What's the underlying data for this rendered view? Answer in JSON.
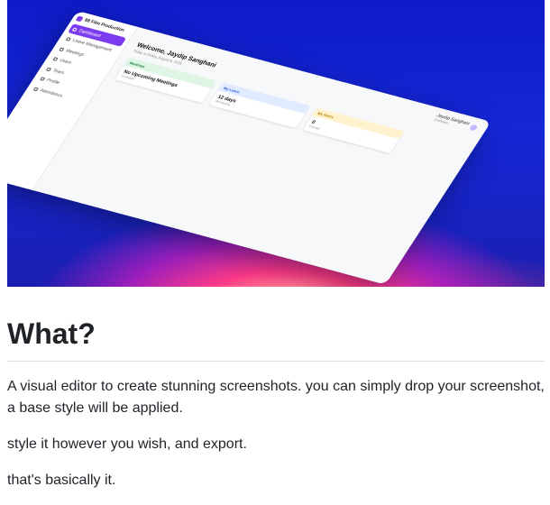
{
  "preview": {
    "app_name": "88 Film Production",
    "nav": [
      "Dashboard",
      "Leave Management",
      "Meetings",
      "Users",
      "Team",
      "Profile",
      "Attendance"
    ],
    "user_name": "Jaydip Sanghani",
    "user_role": "Employee",
    "welcome": "Welcome, Jaydip Sanghani",
    "date_line": "Today is Friday, August 8, 2025",
    "cards": [
      {
        "title": "Meetings",
        "value": "No Upcoming Meetings",
        "sub": "Schedule"
      },
      {
        "title": "My Leave",
        "value": "12 days",
        "sub": "Remaining"
      },
      {
        "title": "My Alerts",
        "value": "0",
        "sub": "Unread"
      }
    ]
  },
  "heading": "What?",
  "paragraphs": [
    "A visual editor to create stunning screenshots. you can simply drop your screenshot, a base style will be applied.",
    "style it however you wish, and export.",
    "that's basically it."
  ]
}
